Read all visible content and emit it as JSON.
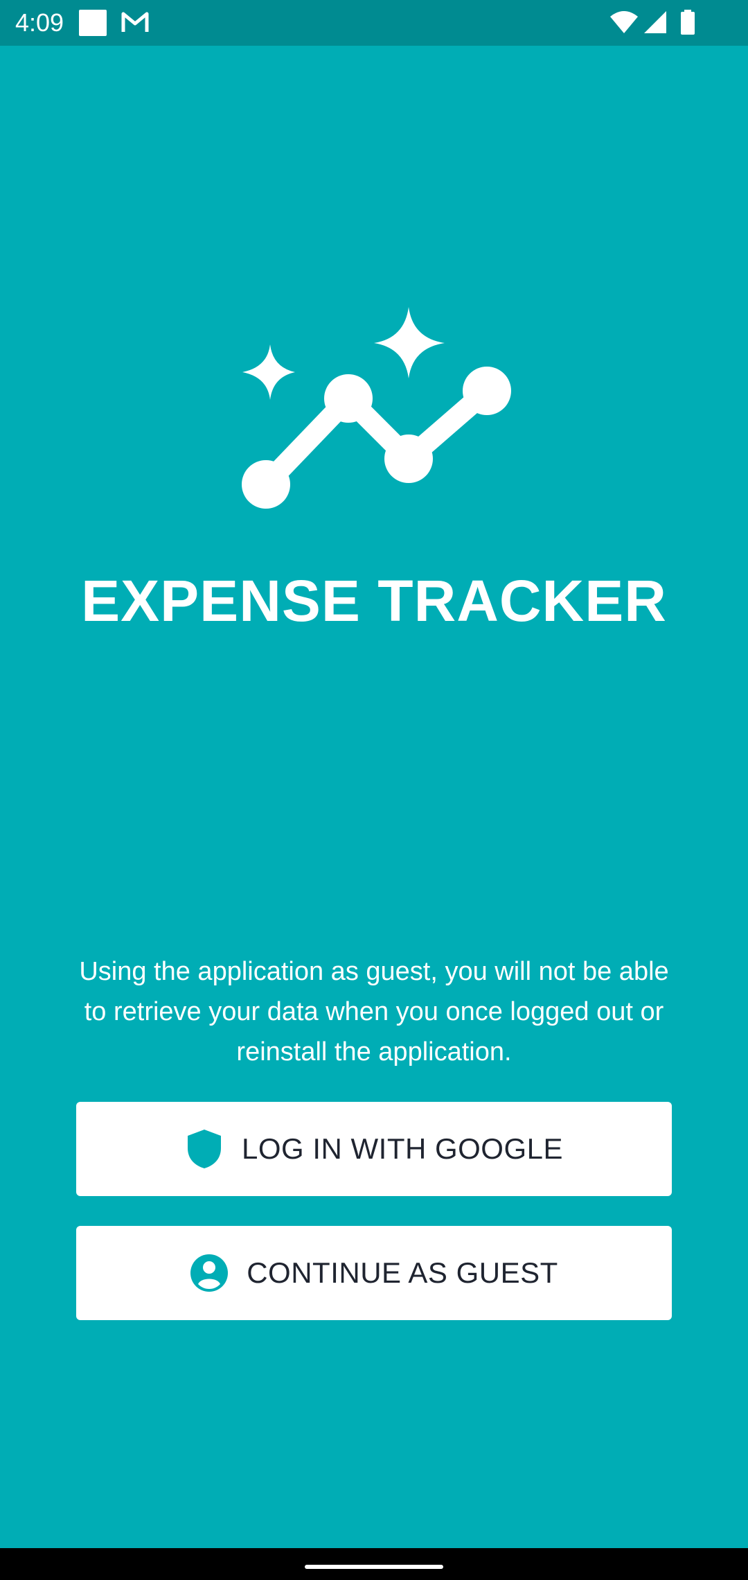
{
  "status_bar": {
    "time": "4:09",
    "icons": [
      "notification-square-icon",
      "gmail-icon",
      "wifi-icon",
      "signal-icon",
      "battery-icon"
    ]
  },
  "app": {
    "logo_icon": "trend-chart-sparkle-icon",
    "title": "EXPENSE TRACKER"
  },
  "guest_note": "Using the application as guest, you will not be able to retrieve your data when you once logged out or reinstall the application.",
  "buttons": {
    "google": {
      "label": "LOG IN WITH GOOGLE",
      "icon": "shield-icon"
    },
    "guest": {
      "label": "CONTINUE AS GUEST",
      "icon": "account-circle-icon"
    }
  },
  "colors": {
    "background": "#00adb5",
    "status_bar": "#008b91",
    "button_bg": "#ffffff",
    "button_text": "#1f2430",
    "accent": "#00adb5"
  }
}
